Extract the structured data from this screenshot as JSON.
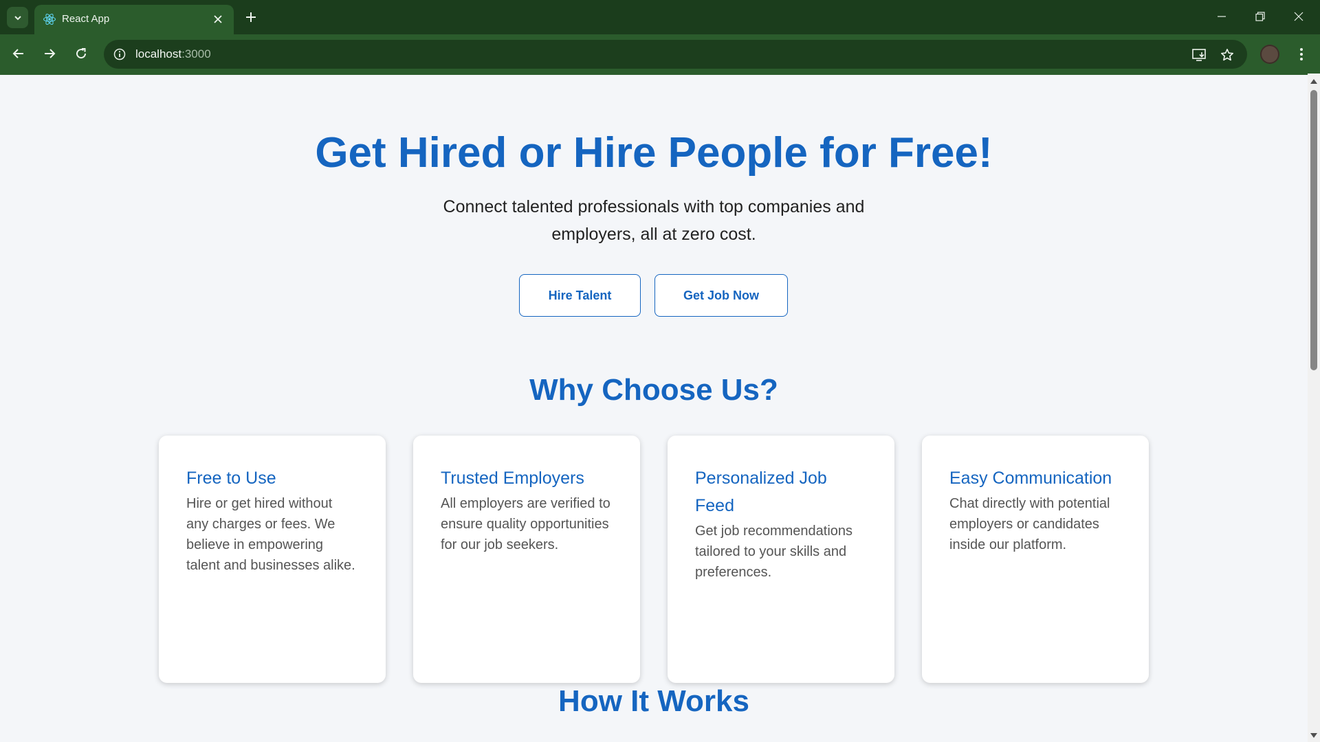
{
  "browser": {
    "tab_title": "React App",
    "url_host": "localhost",
    "url_port": ":3000"
  },
  "hero": {
    "title": "Get Hired or Hire People for Free!",
    "subtitle": "Connect talented professionals with top companies and employers, all at zero cost.",
    "buttons": {
      "hire_talent": "Hire Talent",
      "get_job": "Get Job Now"
    }
  },
  "why": {
    "title": "Why Choose Us?",
    "cards": [
      {
        "title": "Free to Use",
        "text": "Hire or get hired without any charges or fees. We believe in empowering talent and businesses alike."
      },
      {
        "title": "Trusted Employers",
        "text": "All employers are verified to ensure quality opportunities for our job seekers."
      },
      {
        "title": "Personalized Job Feed",
        "text": "Get job recommendations tailored to your skills and preferences."
      },
      {
        "title": "Easy Communication",
        "text": "Chat directly with potential employers or candidates inside our platform."
      }
    ]
  },
  "how": {
    "title": "How It Works"
  },
  "colors": {
    "accent": "#1565c0",
    "chrome_dark": "#1b3d1c",
    "chrome_mid": "#2b5c2c",
    "page_bg": "#f4f6f9"
  }
}
